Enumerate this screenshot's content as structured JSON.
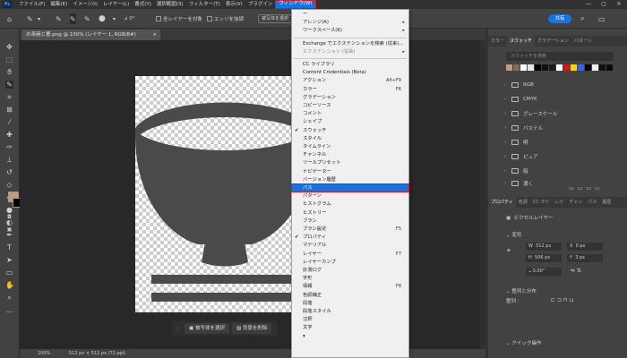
{
  "menubar": {
    "app_logo": "Ps",
    "items": [
      "ファイル(F)",
      "編集(E)",
      "イメージ(I)",
      "レイヤー(L)",
      "書式(Y)",
      "選択範囲(S)",
      "フィルター(T)",
      "表示(V)",
      "プラグイン",
      "ウィンドウ(W)"
    ],
    "active_index": 9,
    "window_controls": [
      "—",
      "▢",
      "✕"
    ]
  },
  "options_bar": {
    "angle": "0°",
    "all_layers_label": "全レイヤーを対象",
    "enhance_edge_label": "エッジを強調",
    "select_subject_label": "被写体を選択",
    "share_label": "共有"
  },
  "document": {
    "tab_title": "お茶碗と箸.png @ 100% (レイヤー 1, RGB/8#)",
    "fill_color": "#4a4a4a"
  },
  "contextual_bar": {
    "select_subject": "被写体を選択",
    "remove_bg": "背景を削除"
  },
  "status": {
    "zoom": "100%",
    "size": "512 px × 512 px (72 ppi)"
  },
  "swatches_panel": {
    "tabs": [
      "カラー",
      "スウォッチ",
      "グラデーション",
      "パターン"
    ],
    "active_tab": 1,
    "search_placeholder": "スウォッチを検索",
    "recent_colors": [
      "#c49a78",
      "#8a6a50",
      "#ffffff",
      "#e8e8e8",
      "#000000",
      "#101010",
      "#1a1a1a",
      "#ffffff",
      "#e01010",
      "#ffd400",
      "#3060ff",
      "#000000",
      "#f0f0f0",
      "#101010",
      "#0a0a0a"
    ],
    "groups": [
      "RGB",
      "CMYK",
      "グレースケール",
      "パステル",
      "明",
      "ピュア",
      "暗",
      "濃く"
    ]
  },
  "properties_panel": {
    "tabs": [
      "プロパティ",
      "色調",
      "CC ライ",
      "レイ",
      "チャン",
      "パス",
      "履歴"
    ],
    "active_tab": 0,
    "layer_type": "ピクセルレイヤー",
    "transform_title": "変形",
    "w": "512 px",
    "h": "506 px",
    "x": "0 px",
    "y": "3 px",
    "angle": "0.00°",
    "align_title": "整列と分布",
    "align_label": "整列 :",
    "quick_actions": "クイック操作"
  },
  "window_menu": {
    "items": [
      {
        "label": "ー",
        "type": "item"
      },
      {
        "label": "アレンジ(A)",
        "type": "submenu"
      },
      {
        "label": "ワークスペース(K)",
        "type": "submenu"
      },
      {
        "type": "sep"
      },
      {
        "label": "Exchange でエクステンションを検索 (従来)...",
        "type": "item"
      },
      {
        "label": "エクステンション (従来)",
        "type": "submenu",
        "disabled": true
      },
      {
        "type": "sep"
      },
      {
        "label": "CC ライブラリ",
        "type": "item"
      },
      {
        "label": "Content Credentials (Beta)",
        "type": "item"
      },
      {
        "label": "アクション",
        "shortcut": "Alt+F9",
        "type": "item"
      },
      {
        "label": "カラー",
        "shortcut": "F6",
        "type": "item"
      },
      {
        "label": "グラデーション",
        "type": "item"
      },
      {
        "label": "コピーソース",
        "type": "item"
      },
      {
        "label": "コメント",
        "type": "item"
      },
      {
        "label": "シェイプ",
        "type": "item"
      },
      {
        "label": "スウォッチ",
        "type": "item",
        "checked": true
      },
      {
        "label": "スタイル",
        "type": "item"
      },
      {
        "label": "タイムライン",
        "type": "item"
      },
      {
        "label": "チャンネル",
        "type": "item"
      },
      {
        "label": "ツールプリセット",
        "type": "item"
      },
      {
        "label": "ナビゲーター",
        "type": "item"
      },
      {
        "label": "バージョン履歴",
        "type": "item"
      },
      {
        "label": "パス",
        "type": "item",
        "highlight": true
      },
      {
        "label": "パターン",
        "type": "item"
      },
      {
        "label": "ヒストグラム",
        "type": "item"
      },
      {
        "label": "ヒストリー",
        "type": "item"
      },
      {
        "label": "ブラシ",
        "type": "item"
      },
      {
        "label": "ブラシ設定",
        "shortcut": "F5",
        "type": "item"
      },
      {
        "label": "プロパティ",
        "type": "item",
        "checked": true
      },
      {
        "label": "マテリアル",
        "type": "item"
      },
      {
        "label": "レイヤー",
        "shortcut": "F7",
        "type": "item"
      },
      {
        "label": "レイヤーカンプ",
        "type": "item"
      },
      {
        "label": "計測ログ",
        "type": "item"
      },
      {
        "label": "字形",
        "type": "item"
      },
      {
        "label": "情報",
        "shortcut": "F8",
        "type": "item"
      },
      {
        "label": "色調補正",
        "type": "item"
      },
      {
        "label": "段落",
        "type": "item"
      },
      {
        "label": "段落スタイル",
        "type": "item"
      },
      {
        "label": "注釈",
        "type": "item"
      },
      {
        "label": "文字",
        "type": "item"
      },
      {
        "label": "▾",
        "type": "item"
      }
    ]
  }
}
